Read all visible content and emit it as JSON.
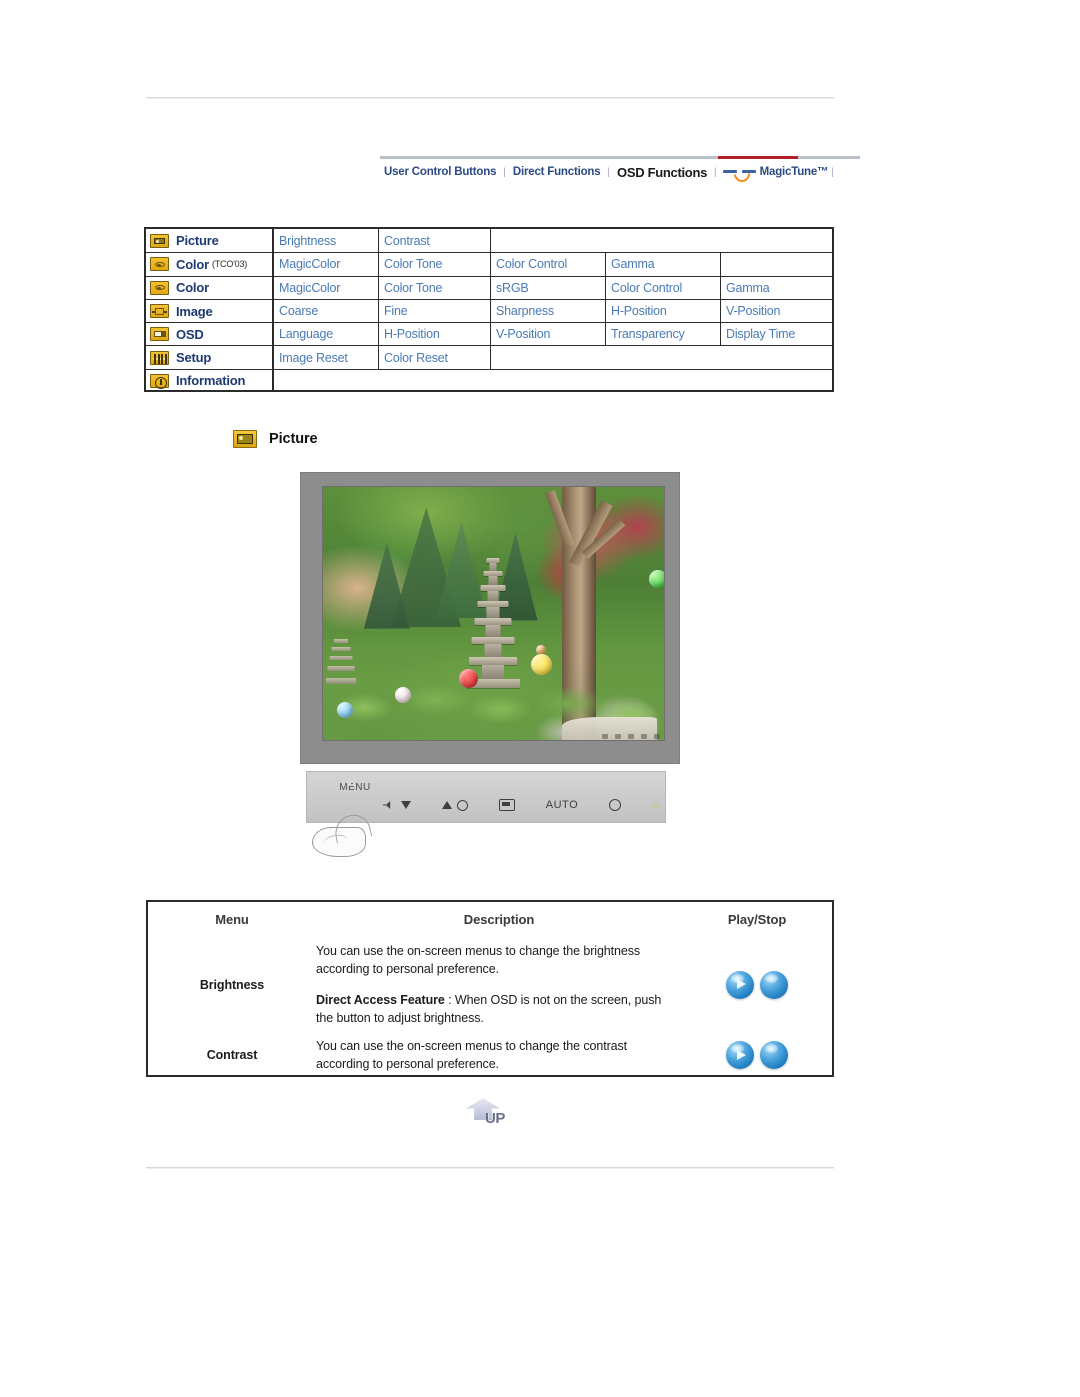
{
  "nav": {
    "items": [
      {
        "label": "User Control Buttons",
        "active": false
      },
      {
        "label": "Direct Functions",
        "active": false
      },
      {
        "label": "OSD Functions",
        "active": true
      },
      {
        "label": "MagicTune™",
        "active": false
      }
    ],
    "separator": "|",
    "accent_active": "#b02024",
    "accent_line": "#b9c0cc",
    "link_color": "#2b4a84"
  },
  "osd_map": {
    "rows": [
      {
        "icon": "picture-icon",
        "category": "Picture",
        "category_sub": "",
        "items": [
          "Brightness",
          "Contrast"
        ]
      },
      {
        "icon": "color-icon",
        "category": "Color",
        "category_sub": "(TCO'03)",
        "items": [
          "MagicColor",
          "Color Tone",
          "Color Control",
          "Gamma"
        ]
      },
      {
        "icon": "color-icon",
        "category": "Color",
        "category_sub": "",
        "items": [
          "MagicColor",
          "Color Tone",
          "sRGB",
          "Color Control",
          "Gamma"
        ]
      },
      {
        "icon": "image-icon",
        "category": "Image",
        "category_sub": "",
        "items": [
          "Coarse",
          "Fine",
          "Sharpness",
          "H-Position",
          "V-Position"
        ]
      },
      {
        "icon": "osd-icon",
        "category": "OSD",
        "category_sub": "",
        "items": [
          "Language",
          "H-Position",
          "V-Position",
          "Transparency",
          "Display Time"
        ]
      },
      {
        "icon": "setup-icon",
        "category": "Setup",
        "category_sub": "",
        "items": [
          "Image Reset",
          "Color Reset"
        ]
      },
      {
        "icon": "information-icon",
        "category": "Information",
        "category_sub": "",
        "items": []
      }
    ],
    "item_color": "#4a7ab5",
    "category_color": "#1e3a73"
  },
  "section": {
    "icon": "picture-icon",
    "title": "Picture"
  },
  "monitor": {
    "bezel_color": "#8d8d8d",
    "screen_alt": "Korean garden with stone pagoda, trees and colored paper lanterns",
    "controls": {
      "menu_label": "MENU",
      "auto_label": "AUTO",
      "glyphs": [
        "menu-icon",
        "sound-icon",
        "down-arrow-icon",
        "up-arrow-icon",
        "brightness-icon",
        "source-icon",
        "auto-icon",
        "power-icon",
        "power-led-icon"
      ]
    }
  },
  "desc_table": {
    "headers": {
      "menu": "Menu",
      "description": "Description",
      "play_stop": "Play/Stop"
    },
    "rows": [
      {
        "menu": "Brightness",
        "paragraphs": [
          {
            "bold": "",
            "text": "You can use the on-screen menus to change the brightness according to personal preference."
          },
          {
            "bold": "Direct Access Feature",
            "text": " : When OSD is not on the screen, push the button to adjust brightness."
          }
        ],
        "play_label": "play-button",
        "stop_label": "stop-button"
      },
      {
        "menu": "Contrast",
        "paragraphs": [
          {
            "bold": "",
            "text": "You can use the on-screen menus to change the contrast according to personal preference."
          }
        ],
        "play_label": "play-button",
        "stop_label": "stop-button"
      }
    ]
  },
  "up_button": {
    "label": "UP"
  }
}
